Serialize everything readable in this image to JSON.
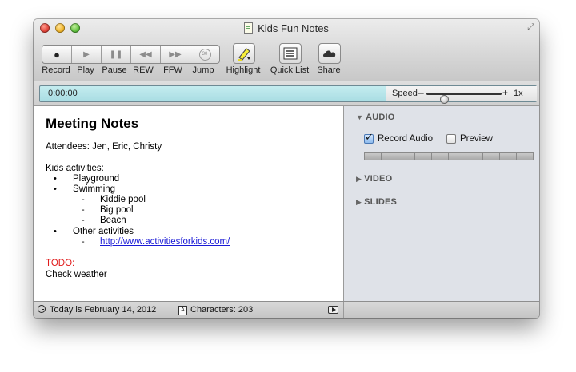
{
  "window": {
    "title": "Kids Fun Notes"
  },
  "toolbar": {
    "record": "Record",
    "play": "Play",
    "pause": "Pause",
    "rew": "REW",
    "ffw": "FFW",
    "jump": "Jump",
    "jump_seconds": "30",
    "highlight": "Highlight",
    "quick_list": "Quick List",
    "share": "Share"
  },
  "timebar": {
    "time": "0:00:00",
    "speed_label": "Speed",
    "speed_minus": "–",
    "speed_plus": "+",
    "speed_value": "1x",
    "speed_level_fraction": 0.2
  },
  "editor": {
    "title": "Meeting Notes",
    "attendees": "Attendees: Jen, Eric, Christy",
    "activities_heading": "Kids activities:",
    "items": {
      "playground": "Playground",
      "swimming": "Swimming",
      "kiddie_pool": "Kiddie pool",
      "big_pool": "Big pool",
      "beach": "Beach",
      "other": "Other activities",
      "link": "http://www.activitiesforkids.com/"
    },
    "bullet_symbol": "•",
    "dash_symbol": "-",
    "todo_label": "TODO:",
    "todo_text": "Check weather"
  },
  "sidebar": {
    "audio": "AUDIO",
    "record_audio": "Record Audio",
    "record_audio_checked": true,
    "preview": "Preview",
    "preview_checked": false,
    "video": "VIDEO",
    "slides": "SLIDES",
    "expanded_marker": "▼",
    "collapsed_marker": "▶"
  },
  "status": {
    "date_text": "Today is February 14, 2012",
    "char_icon_letter": "A",
    "characters": "Characters: 203"
  },
  "colors": {
    "time_field": "#b6e3e8",
    "sidebar_bg": "#dfe2e8",
    "todo_red": "#e01c1c",
    "link_blue": "#1a1ad6"
  },
  "icons": [
    "record-icon",
    "play-icon",
    "pause-icon",
    "rewind-icon",
    "fast-forward-icon",
    "jump-icon",
    "highlighter-icon",
    "list-icon",
    "cloud-icon",
    "clock-icon",
    "play-box-icon",
    "fullscreen-icon",
    "document-icon"
  ]
}
